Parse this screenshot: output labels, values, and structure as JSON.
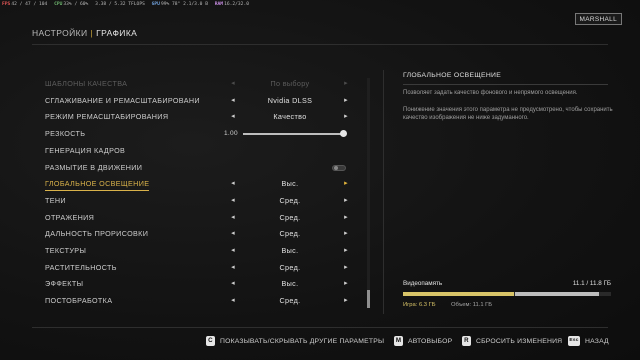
{
  "perf": [
    {
      "key": "FPS",
      "val": "42 / 47 / 104"
    },
    {
      "key": "CPU",
      "val": "33% / 60%"
    },
    {
      "key": "",
      "val": "3.38 / 5.32 TFLOPS"
    },
    {
      "key": "GPU",
      "val": "99%  78°  2.1/3.0 B"
    },
    {
      "key": "RAM",
      "val": "16.2/32.0"
    }
  ],
  "profile_badge": "MARSHALL",
  "breadcrumb": {
    "parent": "НАСТРОЙКИ",
    "separator": "|",
    "current": "ГРАФИКА"
  },
  "settings": [
    {
      "label": "ШАБЛОНЫ КАЧЕСТВА",
      "value": "По выбору",
      "state": "dim",
      "kind": "select"
    },
    {
      "label": "СГЛАЖИВАНИЕ И РЕМАСШТАБИРОВАНИ",
      "value": "Nvidia DLSS",
      "state": "normal",
      "kind": "select"
    },
    {
      "label": "РЕЖИМ РЕМАСШТАБИРОВАНИЯ",
      "value": "Качество",
      "state": "normal",
      "kind": "select"
    },
    {
      "label": "РЕЗКОСТЬ",
      "value": "1.00",
      "state": "normal",
      "kind": "slider",
      "level": 1.0
    },
    {
      "label": "ГЕНЕРАЦИЯ КАДРОВ",
      "value": "",
      "state": "normal",
      "kind": "none"
    },
    {
      "label": "РАЗМЫТИЕ В ДВИЖЕНИИ",
      "value": "",
      "state": "normal",
      "kind": "toggle"
    },
    {
      "label": "ГЛОБАЛЬНОЕ ОСВЕЩЕНИЕ",
      "value": "Выс.",
      "state": "active",
      "kind": "select"
    },
    {
      "label": "ТЕНИ",
      "value": "Сред.",
      "state": "normal",
      "kind": "select"
    },
    {
      "label": "ОТРАЖЕНИЯ",
      "value": "Сред.",
      "state": "normal",
      "kind": "select"
    },
    {
      "label": "ДАЛЬНОСТЬ ПРОРИСОВКИ",
      "value": "Сред.",
      "state": "normal",
      "kind": "select"
    },
    {
      "label": "ТЕКСТУРЫ",
      "value": "Выс.",
      "state": "normal",
      "kind": "select"
    },
    {
      "label": "РАСТИТЕЛЬНОСТЬ",
      "value": "Сред.",
      "state": "normal",
      "kind": "select"
    },
    {
      "label": "ЭФФЕКТЫ",
      "value": "Выс.",
      "state": "normal",
      "kind": "select"
    },
    {
      "label": "ПОСТОБРАБОТКА",
      "value": "Сред.",
      "state": "normal",
      "kind": "select"
    }
  ],
  "info": {
    "title": "ГЛОБАЛЬНОЕ ОСВЕЩЕНИЕ",
    "description": "Позволяет задать качество фонового и непрямого освещения.",
    "warning": "Понижение значения этого параметра не предусмотрено, чтобы сохранить качество изображения не ниже задуманного."
  },
  "vram": {
    "label": "Видеопамять",
    "total_text": "11.1 / 11.8 ГБ",
    "game_text": "Игра: 6.3 ГБ",
    "volume_text": "Объем: 11.1 ГБ",
    "game_fraction": 0.534,
    "used_fraction": 0.941,
    "game_color": "#d8c468",
    "other_color": "#bdbdbd"
  },
  "footer": [
    {
      "key": "C",
      "label": "ПОКАЗЫВАТЬ/СКРЫВАТЬ ДРУГИЕ ПАРАМЕТРЫ"
    },
    {
      "key": "M",
      "label": "АВТОВЫБОР"
    },
    {
      "key": "R",
      "label": "СБРОСИТЬ ИЗМЕНЕНИЯ"
    },
    {
      "key": "Esc",
      "label": "НАЗАД"
    }
  ],
  "accent_color": "#d9b24a"
}
